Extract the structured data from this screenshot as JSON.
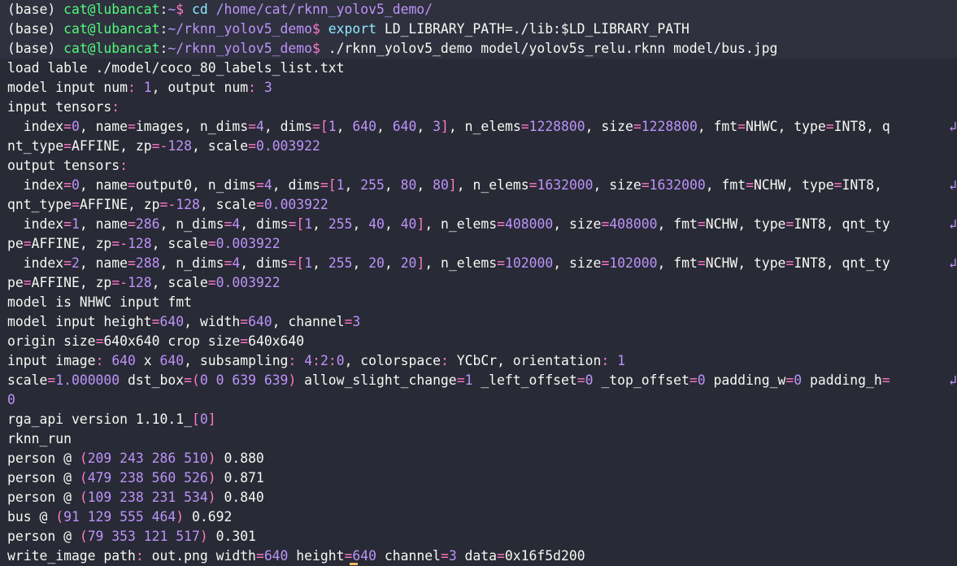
{
  "colors": {
    "background": "#282a36",
    "foreground": "#f8f8f2",
    "user_host": "#50fa7b",
    "path": "#bd93f9",
    "command_keyword": "#8be9fd",
    "number": "#bd93f9",
    "operator": "#ff79c6",
    "cursor": "#ffb86c"
  },
  "lines": [
    {
      "highlight": true,
      "segs": [
        [
          "(base) ",
          "fg"
        ],
        [
          "cat@lubancat",
          "user"
        ],
        [
          ":",
          "fg"
        ],
        [
          "~",
          "path"
        ],
        [
          "$ ",
          "dollar"
        ],
        [
          "cd ",
          "cmd"
        ],
        [
          "/home/cat/rknn_yolov5_demo/",
          "path"
        ]
      ]
    },
    {
      "highlight": true,
      "segs": [
        [
          "(base) ",
          "fg"
        ],
        [
          "cat@lubancat",
          "user"
        ],
        [
          ":",
          "fg"
        ],
        [
          "~/rknn_yolov5_demo",
          "path"
        ],
        [
          "$ ",
          "dollar"
        ],
        [
          "export ",
          "cmd"
        ],
        [
          "LD_LIBRARY_PATH=./lib:$LD_LIBRARY_PATH",
          "fg"
        ]
      ]
    },
    {
      "highlight": true,
      "segs": [
        [
          "(base) ",
          "fg"
        ],
        [
          "cat@lubancat",
          "user"
        ],
        [
          ":",
          "fg"
        ],
        [
          "~/rknn_yolov5_demo",
          "path"
        ],
        [
          "$ ",
          "dollar"
        ],
        [
          "./rknn_yolov5_demo model/yolov5s_relu.rknn model/bus.jpg",
          "fg"
        ]
      ]
    },
    {
      "segs": [
        [
          "load lable ./model/coco_80_labels_list.txt",
          "fg"
        ]
      ]
    },
    {
      "segs": [
        [
          "model input num",
          "fg"
        ],
        [
          ": ",
          "op"
        ],
        [
          "1",
          "num"
        ],
        [
          ", output num",
          "fg"
        ],
        [
          ": ",
          "op"
        ],
        [
          "3",
          "num"
        ]
      ]
    },
    {
      "segs": [
        [
          "input tensors",
          "fg"
        ],
        [
          ":",
          "op"
        ]
      ]
    },
    {
      "wrap": true,
      "segs": [
        [
          "  index",
          "fg"
        ],
        [
          "=",
          "op"
        ],
        [
          "0",
          "num"
        ],
        [
          ", name",
          "fg"
        ],
        [
          "=",
          "op"
        ],
        [
          "images, n_dims",
          "fg"
        ],
        [
          "=",
          "op"
        ],
        [
          "4",
          "num"
        ],
        [
          ", dims",
          "fg"
        ],
        [
          "=[",
          "op"
        ],
        [
          "1",
          "num"
        ],
        [
          ", ",
          "fg"
        ],
        [
          "640",
          "num"
        ],
        [
          ", ",
          "fg"
        ],
        [
          "640",
          "num"
        ],
        [
          ", ",
          "fg"
        ],
        [
          "3",
          "num"
        ],
        [
          "]",
          "op"
        ],
        [
          ", n_elems",
          "fg"
        ],
        [
          "=",
          "op"
        ],
        [
          "1228800",
          "num"
        ],
        [
          ", size",
          "fg"
        ],
        [
          "=",
          "op"
        ],
        [
          "1228800",
          "num"
        ],
        [
          ", fmt",
          "fg"
        ],
        [
          "=",
          "op"
        ],
        [
          "NHWC, type",
          "fg"
        ],
        [
          "=",
          "op"
        ],
        [
          "INT8, q",
          "fg"
        ]
      ]
    },
    {
      "segs": [
        [
          "nt_type",
          "fg"
        ],
        [
          "=",
          "op"
        ],
        [
          "AFFINE, zp",
          "fg"
        ],
        [
          "=-",
          "op"
        ],
        [
          "128",
          "num"
        ],
        [
          ", scale",
          "fg"
        ],
        [
          "=",
          "op"
        ],
        [
          "0.003922",
          "num"
        ]
      ]
    },
    {
      "segs": [
        [
          "output tensors",
          "fg"
        ],
        [
          ":",
          "op"
        ]
      ]
    },
    {
      "wrap": true,
      "segs": [
        [
          "  index",
          "fg"
        ],
        [
          "=",
          "op"
        ],
        [
          "0",
          "num"
        ],
        [
          ", name",
          "fg"
        ],
        [
          "=",
          "op"
        ],
        [
          "output0, n_dims",
          "fg"
        ],
        [
          "=",
          "op"
        ],
        [
          "4",
          "num"
        ],
        [
          ", dims",
          "fg"
        ],
        [
          "=[",
          "op"
        ],
        [
          "1",
          "num"
        ],
        [
          ", ",
          "fg"
        ],
        [
          "255",
          "num"
        ],
        [
          ", ",
          "fg"
        ],
        [
          "80",
          "num"
        ],
        [
          ", ",
          "fg"
        ],
        [
          "80",
          "num"
        ],
        [
          "]",
          "op"
        ],
        [
          ", n_elems",
          "fg"
        ],
        [
          "=",
          "op"
        ],
        [
          "1632000",
          "num"
        ],
        [
          ", size",
          "fg"
        ],
        [
          "=",
          "op"
        ],
        [
          "1632000",
          "num"
        ],
        [
          ", fmt",
          "fg"
        ],
        [
          "=",
          "op"
        ],
        [
          "NCHW, type",
          "fg"
        ],
        [
          "=",
          "op"
        ],
        [
          "INT8, ",
          "fg"
        ]
      ]
    },
    {
      "segs": [
        [
          "qnt_type",
          "fg"
        ],
        [
          "=",
          "op"
        ],
        [
          "AFFINE, zp",
          "fg"
        ],
        [
          "=-",
          "op"
        ],
        [
          "128",
          "num"
        ],
        [
          ", scale",
          "fg"
        ],
        [
          "=",
          "op"
        ],
        [
          "0.003922",
          "num"
        ]
      ]
    },
    {
      "wrap": true,
      "segs": [
        [
          "  index",
          "fg"
        ],
        [
          "=",
          "op"
        ],
        [
          "1",
          "num"
        ],
        [
          ", name",
          "fg"
        ],
        [
          "=",
          "op"
        ],
        [
          "286",
          "num"
        ],
        [
          ", n_dims",
          "fg"
        ],
        [
          "=",
          "op"
        ],
        [
          "4",
          "num"
        ],
        [
          ", dims",
          "fg"
        ],
        [
          "=[",
          "op"
        ],
        [
          "1",
          "num"
        ],
        [
          ", ",
          "fg"
        ],
        [
          "255",
          "num"
        ],
        [
          ", ",
          "fg"
        ],
        [
          "40",
          "num"
        ],
        [
          ", ",
          "fg"
        ],
        [
          "40",
          "num"
        ],
        [
          "]",
          "op"
        ],
        [
          ", n_elems",
          "fg"
        ],
        [
          "=",
          "op"
        ],
        [
          "408000",
          "num"
        ],
        [
          ", size",
          "fg"
        ],
        [
          "=",
          "op"
        ],
        [
          "408000",
          "num"
        ],
        [
          ", fmt",
          "fg"
        ],
        [
          "=",
          "op"
        ],
        [
          "NCHW, type",
          "fg"
        ],
        [
          "=",
          "op"
        ],
        [
          "INT8, qnt_ty",
          "fg"
        ]
      ]
    },
    {
      "segs": [
        [
          "pe",
          "fg"
        ],
        [
          "=",
          "op"
        ],
        [
          "AFFINE, zp",
          "fg"
        ],
        [
          "=-",
          "op"
        ],
        [
          "128",
          "num"
        ],
        [
          ", scale",
          "fg"
        ],
        [
          "=",
          "op"
        ],
        [
          "0.003922",
          "num"
        ]
      ]
    },
    {
      "wrap": true,
      "segs": [
        [
          "  index",
          "fg"
        ],
        [
          "=",
          "op"
        ],
        [
          "2",
          "num"
        ],
        [
          ", name",
          "fg"
        ],
        [
          "=",
          "op"
        ],
        [
          "288",
          "num"
        ],
        [
          ", n_dims",
          "fg"
        ],
        [
          "=",
          "op"
        ],
        [
          "4",
          "num"
        ],
        [
          ", dims",
          "fg"
        ],
        [
          "=[",
          "op"
        ],
        [
          "1",
          "num"
        ],
        [
          ", ",
          "fg"
        ],
        [
          "255",
          "num"
        ],
        [
          ", ",
          "fg"
        ],
        [
          "20",
          "num"
        ],
        [
          ", ",
          "fg"
        ],
        [
          "20",
          "num"
        ],
        [
          "]",
          "op"
        ],
        [
          ", n_elems",
          "fg"
        ],
        [
          "=",
          "op"
        ],
        [
          "102000",
          "num"
        ],
        [
          ", size",
          "fg"
        ],
        [
          "=",
          "op"
        ],
        [
          "102000",
          "num"
        ],
        [
          ", fmt",
          "fg"
        ],
        [
          "=",
          "op"
        ],
        [
          "NCHW, type",
          "fg"
        ],
        [
          "=",
          "op"
        ],
        [
          "INT8, qnt_ty",
          "fg"
        ]
      ]
    },
    {
      "segs": [
        [
          "pe",
          "fg"
        ],
        [
          "=",
          "op"
        ],
        [
          "AFFINE, zp",
          "fg"
        ],
        [
          "=-",
          "op"
        ],
        [
          "128",
          "num"
        ],
        [
          ", scale",
          "fg"
        ],
        [
          "=",
          "op"
        ],
        [
          "0.003922",
          "num"
        ]
      ]
    },
    {
      "segs": [
        [
          "model is NHWC input fmt",
          "fg"
        ]
      ]
    },
    {
      "segs": [
        [
          "model input height",
          "fg"
        ],
        [
          "=",
          "op"
        ],
        [
          "640",
          "num"
        ],
        [
          ", width",
          "fg"
        ],
        [
          "=",
          "op"
        ],
        [
          "640",
          "num"
        ],
        [
          ", channel",
          "fg"
        ],
        [
          "=",
          "op"
        ],
        [
          "3",
          "num"
        ]
      ]
    },
    {
      "segs": [
        [
          "origin size",
          "fg"
        ],
        [
          "=",
          "op"
        ],
        [
          "640x640 crop size",
          "fg"
        ],
        [
          "=",
          "op"
        ],
        [
          "640x640",
          "fg"
        ]
      ]
    },
    {
      "segs": [
        [
          "input image",
          "fg"
        ],
        [
          ": ",
          "op"
        ],
        [
          "640",
          "num"
        ],
        [
          " x ",
          "fg"
        ],
        [
          "640",
          "num"
        ],
        [
          ", subsampling",
          "fg"
        ],
        [
          ": ",
          "op"
        ],
        [
          "4",
          "num"
        ],
        [
          ":",
          "op"
        ],
        [
          "2",
          "num"
        ],
        [
          ":",
          "op"
        ],
        [
          "0",
          "num"
        ],
        [
          ", colorspace",
          "fg"
        ],
        [
          ": ",
          "op"
        ],
        [
          "YCbCr, orientation",
          "fg"
        ],
        [
          ": ",
          "op"
        ],
        [
          "1",
          "num"
        ]
      ]
    },
    {
      "wrap": true,
      "segs": [
        [
          "scale",
          "fg"
        ],
        [
          "=",
          "op"
        ],
        [
          "1.000000",
          "num"
        ],
        [
          " dst_box",
          "fg"
        ],
        [
          "=(",
          "op"
        ],
        [
          "0 0 639 639",
          "num"
        ],
        [
          ")",
          "op"
        ],
        [
          " allow_slight_change",
          "fg"
        ],
        [
          "=",
          "op"
        ],
        [
          "1",
          "num"
        ],
        [
          " _left_offset",
          "fg"
        ],
        [
          "=",
          "op"
        ],
        [
          "0",
          "num"
        ],
        [
          " _top_offset",
          "fg"
        ],
        [
          "=",
          "op"
        ],
        [
          "0",
          "num"
        ],
        [
          " padding_w",
          "fg"
        ],
        [
          "=",
          "op"
        ],
        [
          "0",
          "num"
        ],
        [
          " padding_h",
          "fg"
        ],
        [
          "=",
          "op"
        ]
      ]
    },
    {
      "segs": [
        [
          "0",
          "num"
        ]
      ]
    },
    {
      "segs": [
        [
          "rga_api version 1.10.1_",
          "fg"
        ],
        [
          "[",
          "op"
        ],
        [
          "0",
          "num"
        ],
        [
          "]",
          "op"
        ]
      ]
    },
    {
      "segs": [
        [
          "rknn_run",
          "fg"
        ]
      ]
    },
    {
      "segs": [
        [
          "person @ ",
          "fg"
        ],
        [
          "(",
          "op"
        ],
        [
          "209 243 286 510",
          "num"
        ],
        [
          ")",
          "op"
        ],
        [
          " 0.880",
          "fg"
        ]
      ]
    },
    {
      "segs": [
        [
          "person @ ",
          "fg"
        ],
        [
          "(",
          "op"
        ],
        [
          "479 238 560 526",
          "num"
        ],
        [
          ")",
          "op"
        ],
        [
          " 0.871",
          "fg"
        ]
      ]
    },
    {
      "segs": [
        [
          "person @ ",
          "fg"
        ],
        [
          "(",
          "op"
        ],
        [
          "109 238 231 534",
          "num"
        ],
        [
          ")",
          "op"
        ],
        [
          " 0.840",
          "fg"
        ]
      ]
    },
    {
      "segs": [
        [
          "bus @ ",
          "fg"
        ],
        [
          "(",
          "op"
        ],
        [
          "91 129 555 464",
          "num"
        ],
        [
          ")",
          "op"
        ],
        [
          " 0.692",
          "fg"
        ]
      ]
    },
    {
      "segs": [
        [
          "person @ ",
          "fg"
        ],
        [
          "(",
          "op"
        ],
        [
          "79 353 121 517",
          "num"
        ],
        [
          ")",
          "op"
        ],
        [
          " 0.301",
          "fg"
        ]
      ]
    },
    {
      "segs": [
        [
          "write_image path",
          "fg"
        ],
        [
          ": ",
          "op"
        ],
        [
          "out.png width",
          "fg"
        ],
        [
          "=",
          "op"
        ],
        [
          "640",
          "num"
        ],
        [
          " height",
          "fg"
        ],
        [
          "=",
          "op"
        ],
        [
          "640",
          "num"
        ],
        [
          " channel",
          "fg"
        ],
        [
          "=",
          "op"
        ],
        [
          "3",
          "num"
        ],
        [
          " data",
          "fg"
        ],
        [
          "=",
          "op"
        ],
        [
          "0x16f5d200",
          "fg"
        ]
      ]
    }
  ],
  "wrap_glyph": "↲"
}
